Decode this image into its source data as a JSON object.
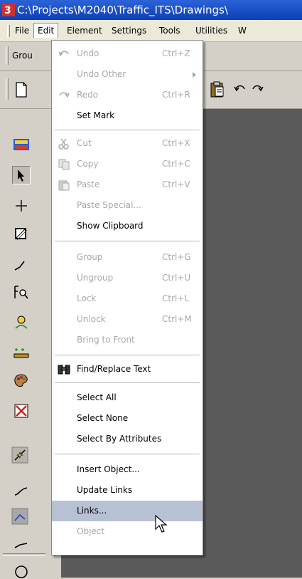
{
  "window": {
    "title": "C:\\Projects\\M2040\\Traffic_ITS\\Drawings\\"
  },
  "menubar": {
    "items": [
      {
        "label": "File",
        "ul": "F"
      },
      {
        "label": "Edit",
        "ul": "E"
      },
      {
        "label": "Element",
        "ul": ""
      },
      {
        "label": "Settings",
        "ul": "S"
      },
      {
        "label": "Tools",
        "ul": "T"
      },
      {
        "label": "Utilities",
        "ul": "U"
      },
      {
        "label": "W",
        "ul": ""
      }
    ]
  },
  "toolbar": {
    "group_label": "Grou"
  },
  "edit_menu": {
    "items": [
      {
        "label": "Undo",
        "shortcut": "Ctrl+Z",
        "disabled": true
      },
      {
        "label": "Undo Other",
        "shortcut": "",
        "disabled": true,
        "submenu": true
      },
      {
        "label": "Redo",
        "shortcut": "Ctrl+R",
        "disabled": true
      },
      {
        "label": "Set Mark",
        "shortcut": "",
        "disabled": false
      },
      {
        "label": "Cut",
        "shortcut": "Ctrl+X",
        "disabled": true
      },
      {
        "label": "Copy",
        "shortcut": "Ctrl+C",
        "disabled": true
      },
      {
        "label": "Paste",
        "shortcut": "Ctrl+V",
        "disabled": true
      },
      {
        "label": "Paste Special...",
        "shortcut": "",
        "disabled": true
      },
      {
        "label": "Show Clipboard",
        "shortcut": "",
        "disabled": false
      },
      {
        "label": "Group",
        "shortcut": "Ctrl+G",
        "disabled": true
      },
      {
        "label": "Ungroup",
        "shortcut": "Ctrl+U",
        "disabled": true
      },
      {
        "label": "Lock",
        "shortcut": "Ctrl+L",
        "disabled": true
      },
      {
        "label": "Unlock",
        "shortcut": "Ctrl+M",
        "disabled": true
      },
      {
        "label": "Bring to Front",
        "shortcut": "",
        "disabled": true
      },
      {
        "label": "Find/Replace Text",
        "shortcut": "",
        "disabled": false
      },
      {
        "label": "Select All",
        "shortcut": "",
        "disabled": false
      },
      {
        "label": "Select None",
        "shortcut": "",
        "disabled": false
      },
      {
        "label": "Select By Attributes",
        "shortcut": "",
        "disabled": false
      },
      {
        "label": "Insert Object...",
        "shortcut": "",
        "disabled": false
      },
      {
        "label": "Update Links",
        "shortcut": "",
        "disabled": false
      },
      {
        "label": "Links...",
        "shortcut": "",
        "disabled": false,
        "highlighted": true
      },
      {
        "label": "Object",
        "shortcut": "",
        "disabled": true
      }
    ]
  }
}
